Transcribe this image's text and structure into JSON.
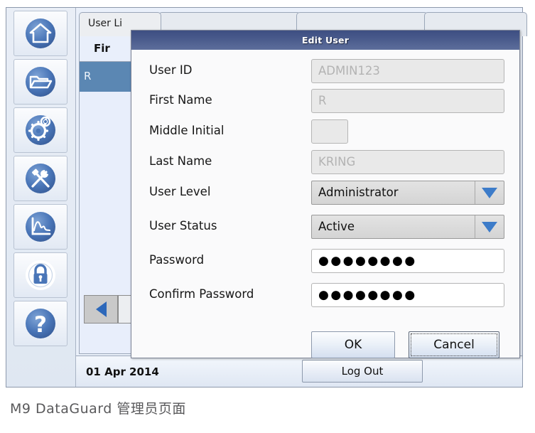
{
  "caption": "M9  DataGuard  管理员页面",
  "sidebar": {
    "items": [
      {
        "name": "home",
        "icon": "home-icon",
        "selected": false
      },
      {
        "name": "files",
        "icon": "folder-icon",
        "selected": false
      },
      {
        "name": "settings",
        "icon": "gears-icon",
        "selected": false
      },
      {
        "name": "tools",
        "icon": "tools-icon",
        "selected": false
      },
      {
        "name": "trends",
        "icon": "chart-icon",
        "selected": false
      },
      {
        "name": "security",
        "icon": "lock-icon",
        "selected": true
      },
      {
        "name": "help",
        "icon": "question-icon",
        "selected": false
      }
    ]
  },
  "tabs": [
    {
      "label": "User Li"
    },
    {
      "label": ""
    },
    {
      "label": ""
    },
    {
      "label": ""
    }
  ],
  "grid": {
    "columns": [
      "Fir"
    ],
    "rows": [
      {
        "first": "R",
        "selected": true
      }
    ],
    "pager_prev_icon": "triangle-left-icon"
  },
  "statusbar": {
    "date": "01 Apr 2014",
    "logout_label": "Log Out"
  },
  "dialog": {
    "title": "Edit User",
    "fields": [
      {
        "label": "User ID",
        "value": "ADMIN123",
        "type": "text",
        "disabled": true
      },
      {
        "label": "First Name",
        "value": "R",
        "type": "text",
        "disabled": true
      },
      {
        "label": "Middle Initial",
        "value": "",
        "type": "text",
        "disabled": true,
        "narrow": true
      },
      {
        "label": "Last Name",
        "value": "KRING",
        "type": "text",
        "disabled": true
      },
      {
        "label": "User Level",
        "value": "Administrator",
        "type": "select",
        "disabled": false
      },
      {
        "label": "User Status",
        "value": "Active",
        "type": "select",
        "disabled": false
      },
      {
        "label": "Password",
        "value": "●●●●●●●●",
        "type": "password",
        "disabled": false
      },
      {
        "label": "Confirm Password",
        "value": "●●●●●●●●",
        "type": "password",
        "disabled": false
      }
    ],
    "ok_label": "OK",
    "cancel_label": "Cancel"
  },
  "colors": {
    "title_bar_dark": "#3d4e82",
    "title_bar_light": "#5d6e9b",
    "row_selected": "#5b87b3",
    "icon_blue": "#4a76b8",
    "arrow_blue": "#3d7cc9"
  }
}
